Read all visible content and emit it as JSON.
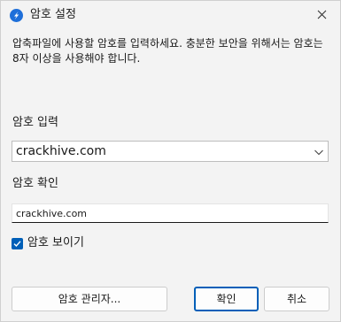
{
  "window": {
    "title": "암호 설정",
    "icon": "blue-app-icon",
    "close_icon": "close-icon"
  },
  "description": "압축파일에 사용할 암호를 입력하세요. 충분한 보안을 위해서는 암호는 8자 이상을 사용해야 합니다.",
  "password": {
    "label": "암호 입력",
    "value": "crackhive.com",
    "dropdown_icon": "chevron-down-icon"
  },
  "confirm": {
    "label": "암호 확인",
    "value": "crackhive.com"
  },
  "show_password": {
    "label": "암호 보이기",
    "checked": true
  },
  "buttons": {
    "manager": "암호 관리자...",
    "ok": "확인",
    "cancel": "취소"
  },
  "colors": {
    "accent": "#005fb8",
    "background": "#f3f3f3"
  }
}
